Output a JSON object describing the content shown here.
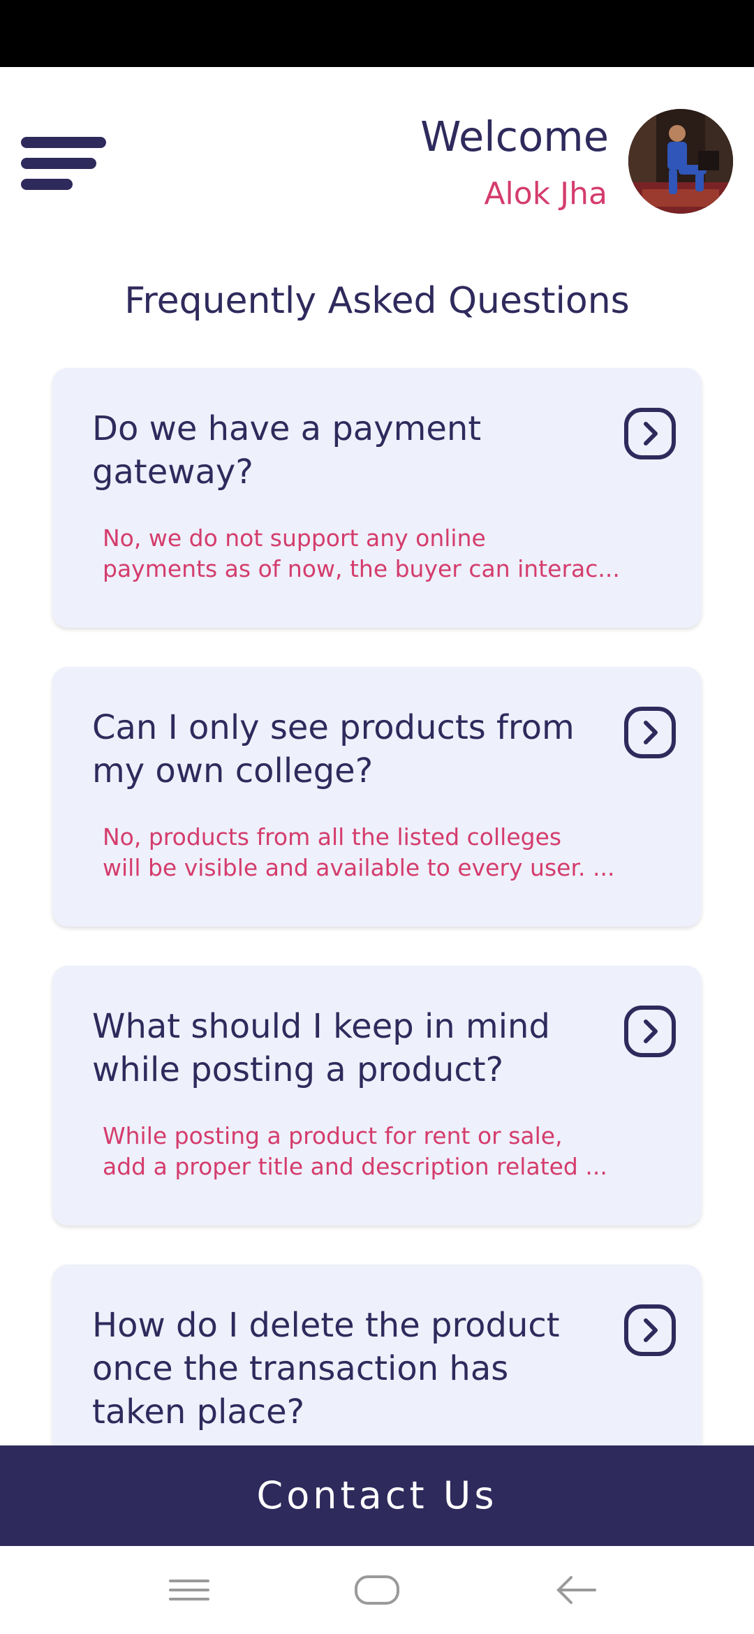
{
  "header": {
    "welcome": "Welcome",
    "user_name": "Alok Jha",
    "menu_icon": "hamburger-icon",
    "avatar": "user-avatar-photo"
  },
  "page_title": "Frequently Asked Questions",
  "faqs": [
    {
      "question_lines": [
        "Do we have a payment",
        "gateway?"
      ],
      "answer_lines": [
        "No, we do not support any online",
        "payments as of now, the buyer can interac..."
      ]
    },
    {
      "question_lines": [
        "Can I only see products from",
        "my own college?"
      ],
      "answer_lines": [
        "No, products from all the listed colleges",
        "will be visible and available to every user. ..."
      ]
    },
    {
      "question_lines": [
        "What should I keep in mind",
        "while posting a product?"
      ],
      "answer_lines": [
        "While posting a product for rent or sale,",
        "add a proper title and description related ..."
      ]
    },
    {
      "question_lines": [
        "How do I delete the product",
        "once the transaction has",
        "taken place?"
      ],
      "answer_lines": []
    }
  ],
  "contact_button": "Contact Us",
  "colors": {
    "primary": "#2f2a5c",
    "accent": "#d43c6c",
    "card": "#eef0fb"
  },
  "system_nav": [
    "menu-icon",
    "home-icon",
    "back-icon"
  ]
}
